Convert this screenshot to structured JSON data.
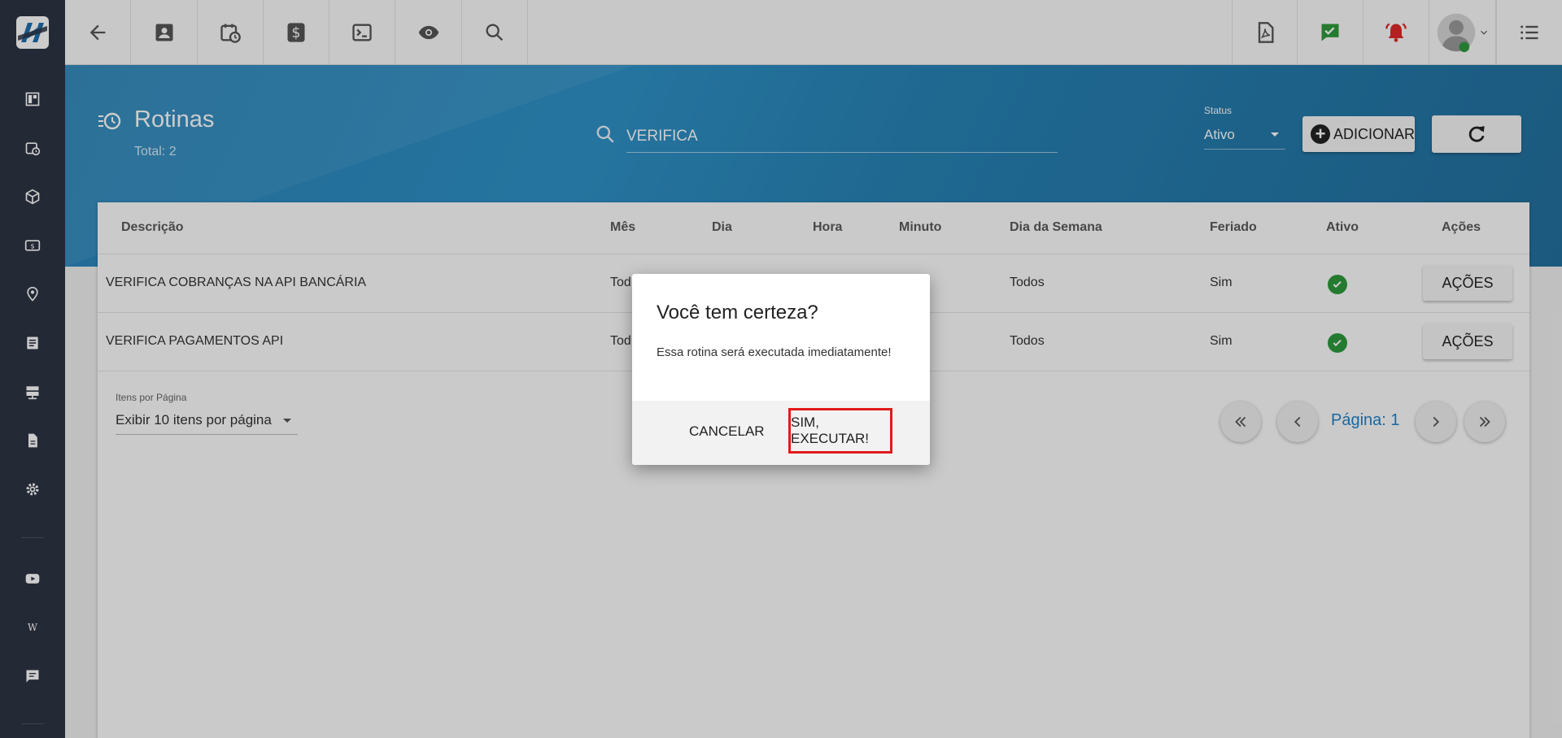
{
  "topbar": {
    "left_icons": [
      "back-arrow-icon",
      "contact-card-icon",
      "calendar-clock-icon",
      "dollar-icon",
      "terminal-icon",
      "eye-icon",
      "search-icon"
    ],
    "right_icons": [
      "pdf-icon",
      "chat-check-icon",
      "alarm-bell-icon",
      "user-avatar",
      "menu-list-icon"
    ],
    "accent_colors": {
      "chat_check": "#2e9a3c",
      "alarm": "#e02a2a"
    }
  },
  "sidebar": {
    "icons": [
      "dashboard-icon",
      "calendar-clock-icon",
      "package-icon",
      "money-icon",
      "location-icon",
      "document-list-icon",
      "server-icon",
      "file-icon",
      "settings-icon",
      "youtube-icon",
      "wikipedia-icon",
      "chat-icon"
    ]
  },
  "header": {
    "title": "Rotinas",
    "total": "Total: 2",
    "search_value": "VERIFICA",
    "status_label": "Status",
    "status_value": "Ativo",
    "add_label": "ADICIONAR"
  },
  "table": {
    "columns": [
      "Descrição",
      "Mês",
      "Dia",
      "Hora",
      "Minuto",
      "Dia da Semana",
      "Feriado",
      "Ativo",
      "Ações"
    ],
    "rows": [
      {
        "descricao": "VERIFICA COBRANÇAS NA API BANCÁRIA",
        "mes": "Tod",
        "dia_semana": "Todos",
        "feriado": "Sim",
        "ativo": true,
        "acoes": "AÇÕES"
      },
      {
        "descricao": "VERIFICA PAGAMENTOS API",
        "mes": "Tod",
        "dia_semana": "Todos",
        "feriado": "Sim",
        "ativo": true,
        "acoes": "AÇÕES"
      }
    ]
  },
  "pagination": {
    "per_page_label": "Itens por Página",
    "per_page_value": "Exibir 10 itens por página",
    "page_label": "Página: 1"
  },
  "dialog": {
    "title": "Você tem certeza?",
    "message": "Essa rotina será executada imediatamente!",
    "cancel": "CANCELAR",
    "confirm": "SIM, EXECUTAR!"
  }
}
